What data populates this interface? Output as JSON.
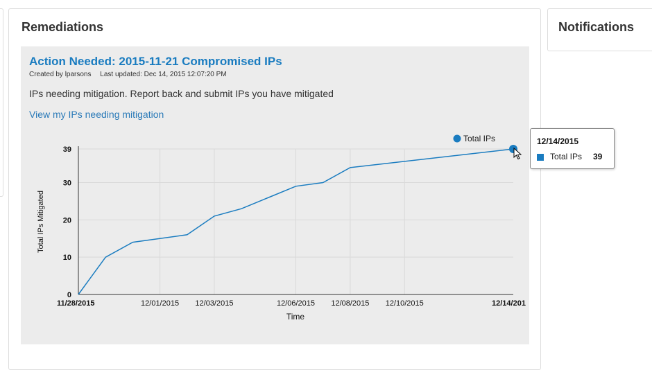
{
  "remediations": {
    "title": "Remediations",
    "card": {
      "title": "Action Needed: 2015-11-21 Compromised IPs",
      "created_by": "Created by lparsons",
      "last_updated": "Last updated: Dec 14, 2015 12:07:20 PM",
      "description": "IPs needing mitigation. Report back and submit IPs you have mitigated",
      "link": "View my IPs needing mitigation"
    }
  },
  "notifications": {
    "title": "Notifications"
  },
  "colors": {
    "line": "#1a7cc0",
    "link": "#2a7ab8",
    "card_bg": "#ececec"
  },
  "tooltip": {
    "date": "12/14/2015",
    "label": "Total IPs",
    "value": "39"
  },
  "chart_data": {
    "type": "line",
    "xlabel": "Time",
    "ylabel": "Total IPs Mitigated",
    "ylim": [
      0,
      39
    ],
    "yticks": [
      "0",
      "10",
      "20",
      "30",
      "39"
    ],
    "xticks": [
      "11/28/2015",
      "12/01/2015",
      "12/03/2015",
      "12/06/2015",
      "12/08/2015",
      "12/10/2015",
      "12/14/201"
    ],
    "legend": "top-right",
    "series": [
      {
        "name": "Total IPs",
        "x": [
          "2015-11-28",
          "2015-11-29",
          "2015-11-30",
          "2015-12-02",
          "2015-12-03",
          "2015-12-04",
          "2015-12-05",
          "2015-12-06",
          "2015-12-07",
          "2015-12-08",
          "2015-12-14"
        ],
        "y": [
          0,
          10,
          14,
          16,
          21,
          23,
          26,
          29,
          30,
          34,
          39
        ]
      }
    ]
  }
}
